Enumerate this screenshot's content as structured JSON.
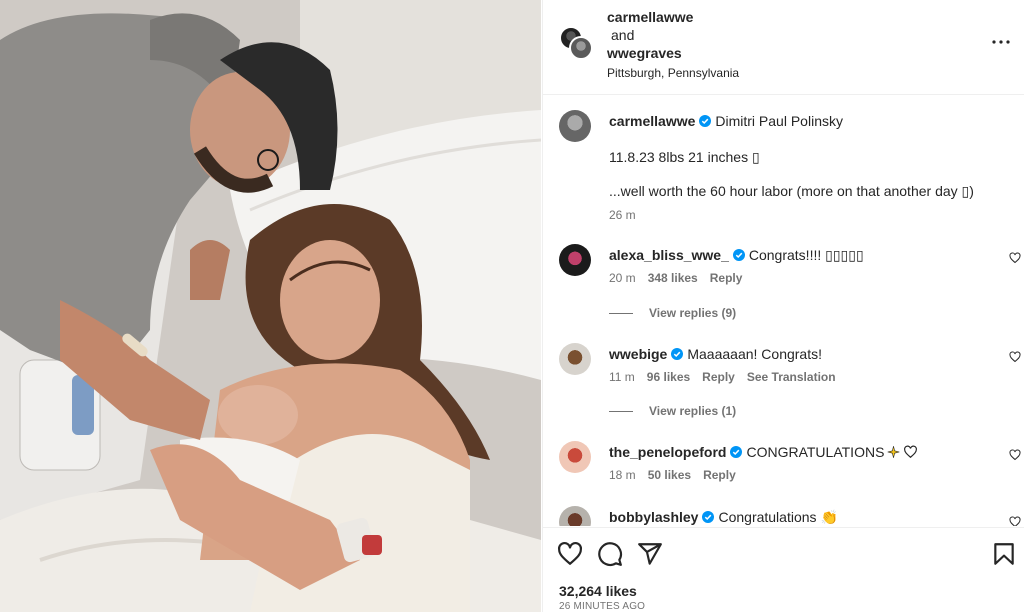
{
  "post_header": {
    "user1": "carmellawwe",
    "and": "and",
    "user2": "wwegraves",
    "location": "Pittsburgh, Pennsylvania"
  },
  "caption": {
    "username": "carmellawwe",
    "line1": "Dimitri Paul Polinsky",
    "line2": "11.8.23 8lbs 21 inches ▯",
    "line3": "...well worth the 60 hour labor (more on that another day ▯)",
    "time": "26 m"
  },
  "comments": [
    {
      "username": "alexa_bliss_wwe_",
      "text": "Congrats!!!! ▯▯▯▯▯",
      "time": "20 m",
      "likes": "348 likes",
      "reply": "Reply",
      "view_replies": "View replies (9)"
    },
    {
      "username": "wwebige",
      "text": "Maaaaaan! Congrats!",
      "time": "11 m",
      "likes": "96 likes",
      "reply": "Reply",
      "translation": "See Translation",
      "view_replies": "View replies (1)"
    },
    {
      "username": "the_penelopeford",
      "text": "CONGRATULATIONS",
      "time": "18 m",
      "likes": "50 likes",
      "reply": "Reply"
    },
    {
      "username": "bobbylashley",
      "text": "Congratulations"
    }
  ],
  "footer": {
    "likes": "32,264 likes",
    "time": "26 MINUTES AGO"
  },
  "colors": {
    "verified": "#0095f6",
    "text": "#262626",
    "secondary": "#737373"
  },
  "icons": [
    "more-icon",
    "verified-icon",
    "heart-icon",
    "comment-icon",
    "share-icon",
    "bookmark-icon"
  ]
}
